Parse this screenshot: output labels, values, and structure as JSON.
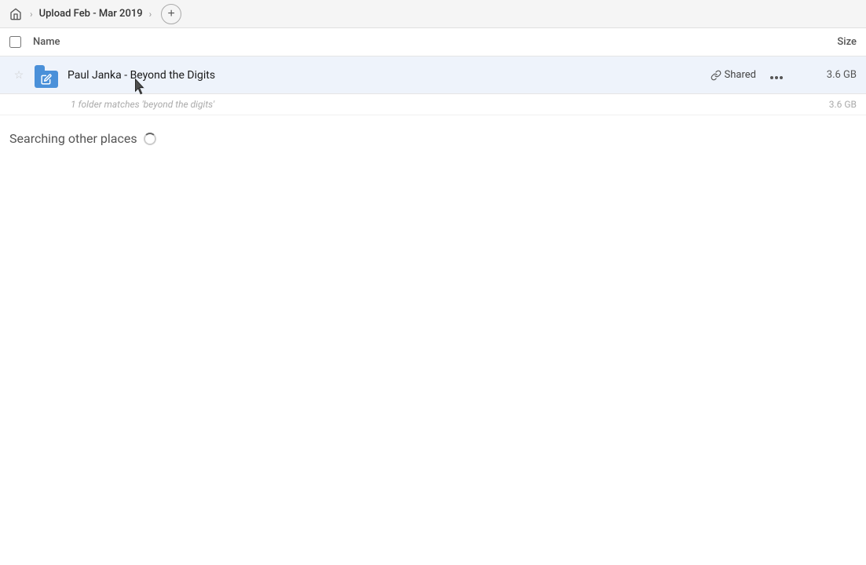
{
  "header": {
    "home_icon": "home",
    "breadcrumb": "Upload Feb - Mar 2019",
    "add_button": "+"
  },
  "columns": {
    "name_label": "Name",
    "size_label": "Size"
  },
  "file_row": {
    "name": "Paul Janka - Beyond the Digits",
    "shared_label": "Shared",
    "size": "3.6 GB",
    "star_icon": "★"
  },
  "match_note": {
    "text": "1 folder matches 'beyond the digits'",
    "size": "3.6 GB"
  },
  "searching": {
    "label": "Searching other places"
  }
}
